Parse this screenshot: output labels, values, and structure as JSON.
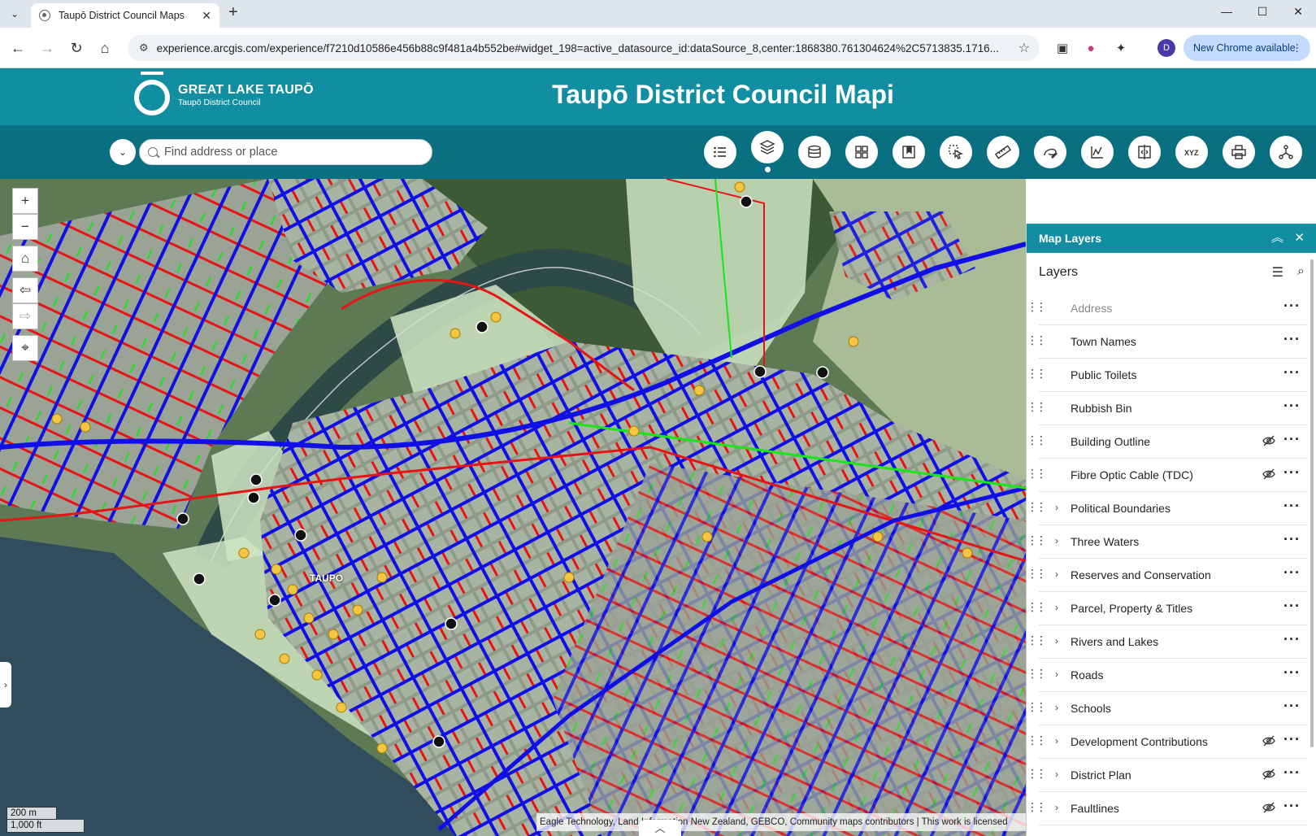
{
  "browser": {
    "tab_title": "Taupō District Council Maps",
    "url": "experience.arcgis.com/experience/f7210d10586e456b88c9f481a4b552be#widget_198=active_datasource_id:dataSource_8,center:1868380.761304624%2C5713835.1716...",
    "profile_initial": "D",
    "update_label": "New Chrome available"
  },
  "header": {
    "logo_main": "GREAT LAKE TAUPŌ",
    "logo_sub": "Taupō District Council",
    "title": "Taupō District Council Mapi"
  },
  "search": {
    "placeholder": "Find address or place"
  },
  "toolbar": {
    "tools": [
      "legend-icon",
      "layers-icon",
      "basemap-icon",
      "apps-grid-icon",
      "bookmark-icon",
      "select-icon",
      "measure-icon",
      "draw-icon",
      "chart-icon",
      "swipe-icon",
      "coordinates-icon",
      "print-icon",
      "share-icon"
    ],
    "active_tool": "layers-icon"
  },
  "map": {
    "place_label": "TAUPO",
    "scale_metric": "200 m",
    "scale_imperial": "1,000 ft",
    "attribution": "Eagle Technology, Land Information New Zealand, GEBCO, Community maps contributors | This work is licensed",
    "colors": {
      "water_mains": "#1010e6",
      "wastewater": "#e61414",
      "stormwater": "#17e617",
      "reserves": "#cfe5c4",
      "lake": "#2f4d5c"
    }
  },
  "panel": {
    "title": "Map Layers",
    "section": "Layers",
    "layers": [
      {
        "name": "Address",
        "group": false,
        "hidden": false,
        "muted": true
      },
      {
        "name": "Town Names",
        "group": false,
        "hidden": false
      },
      {
        "name": "Public Toilets",
        "group": false,
        "hidden": false
      },
      {
        "name": "Rubbish Bin",
        "group": false,
        "hidden": false
      },
      {
        "name": "Building Outline",
        "group": false,
        "hidden": true
      },
      {
        "name": "Fibre Optic Cable (TDC)",
        "group": false,
        "hidden": true
      },
      {
        "name": "Political Boundaries",
        "group": true,
        "hidden": false
      },
      {
        "name": "Three Waters",
        "group": true,
        "hidden": false
      },
      {
        "name": "Reserves and Conservation",
        "group": true,
        "hidden": false
      },
      {
        "name": "Parcel, Property & Titles",
        "group": true,
        "hidden": false
      },
      {
        "name": "Rivers and Lakes",
        "group": true,
        "hidden": false
      },
      {
        "name": "Roads",
        "group": true,
        "hidden": false
      },
      {
        "name": "Schools",
        "group": true,
        "hidden": false
      },
      {
        "name": "Development Contributions",
        "group": true,
        "hidden": true
      },
      {
        "name": "District Plan",
        "group": true,
        "hidden": true
      },
      {
        "name": "Faultlines",
        "group": true,
        "hidden": true
      }
    ]
  }
}
